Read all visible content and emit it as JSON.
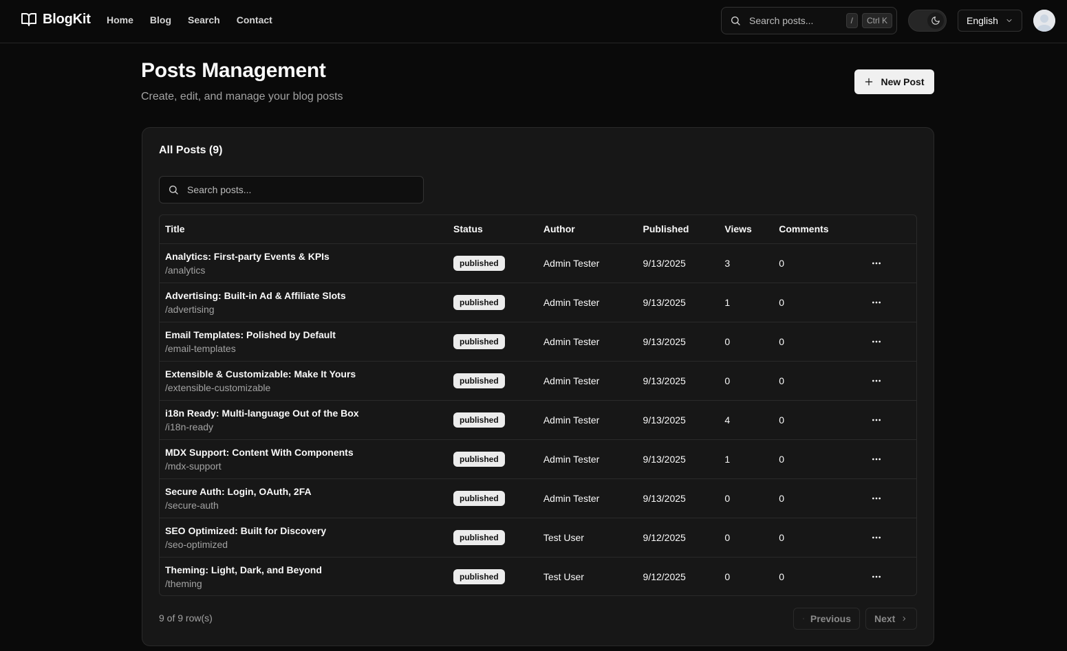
{
  "brand": {
    "name": "BlogKit"
  },
  "nav": {
    "links": [
      {
        "label": "Home"
      },
      {
        "label": "Blog"
      },
      {
        "label": "Search"
      },
      {
        "label": "Contact"
      }
    ],
    "search": {
      "placeholder": "Search posts...",
      "shortcut_slash": "/",
      "shortcut_ctrl": "Ctrl K"
    },
    "theme_toggle": {
      "mode": "dark",
      "icon": "moon-icon"
    },
    "language": {
      "selected": "English"
    },
    "avatar": {
      "icon": "user-avatar-icon"
    }
  },
  "page": {
    "title": "Posts Management",
    "subtitle": "Create, edit, and manage your blog posts",
    "new_post_label": "New Post"
  },
  "posts_card": {
    "title": "All Posts (9)",
    "search_placeholder": "Search posts...",
    "columns": {
      "title": "Title",
      "status": "Status",
      "author": "Author",
      "published": "Published",
      "views": "Views",
      "comments": "Comments"
    },
    "rows": [
      {
        "title": "Analytics: First-party Events & KPIs",
        "slug": "/analytics",
        "status": "published",
        "author": "Admin Tester",
        "published": "9/13/2025",
        "views": "3",
        "comments": "0"
      },
      {
        "title": "Advertising: Built-in Ad & Affiliate Slots",
        "slug": "/advertising",
        "status": "published",
        "author": "Admin Tester",
        "published": "9/13/2025",
        "views": "1",
        "comments": "0"
      },
      {
        "title": "Email Templates: Polished by Default",
        "slug": "/email-templates",
        "status": "published",
        "author": "Admin Tester",
        "published": "9/13/2025",
        "views": "0",
        "comments": "0"
      },
      {
        "title": "Extensible & Customizable: Make It Yours",
        "slug": "/extensible-customizable",
        "status": "published",
        "author": "Admin Tester",
        "published": "9/13/2025",
        "views": "0",
        "comments": "0"
      },
      {
        "title": "i18n Ready: Multi-language Out of the Box",
        "slug": "/i18n-ready",
        "status": "published",
        "author": "Admin Tester",
        "published": "9/13/2025",
        "views": "4",
        "comments": "0"
      },
      {
        "title": "MDX Support: Content With Components",
        "slug": "/mdx-support",
        "status": "published",
        "author": "Admin Tester",
        "published": "9/13/2025",
        "views": "1",
        "comments": "0"
      },
      {
        "title": "Secure Auth: Login, OAuth, 2FA",
        "slug": "/secure-auth",
        "status": "published",
        "author": "Admin Tester",
        "published": "9/13/2025",
        "views": "0",
        "comments": "0"
      },
      {
        "title": "SEO Optimized: Built for Discovery",
        "slug": "/seo-optimized",
        "status": "published",
        "author": "Test User",
        "published": "9/12/2025",
        "views": "0",
        "comments": "0"
      },
      {
        "title": "Theming: Light, Dark, and Beyond",
        "slug": "/theming",
        "status": "published",
        "author": "Test User",
        "published": "9/12/2025",
        "views": "0",
        "comments": "0"
      }
    ],
    "row_count": "9 of 9 row(s)",
    "pagination": {
      "previous": "Previous",
      "next": "Next"
    }
  },
  "colors": {
    "background": "#0a0a0a",
    "card": "#171717",
    "border": "#2a2a2a",
    "text": "#fafafa",
    "muted": "#a3a3a3",
    "badge_bg": "#ececec"
  }
}
